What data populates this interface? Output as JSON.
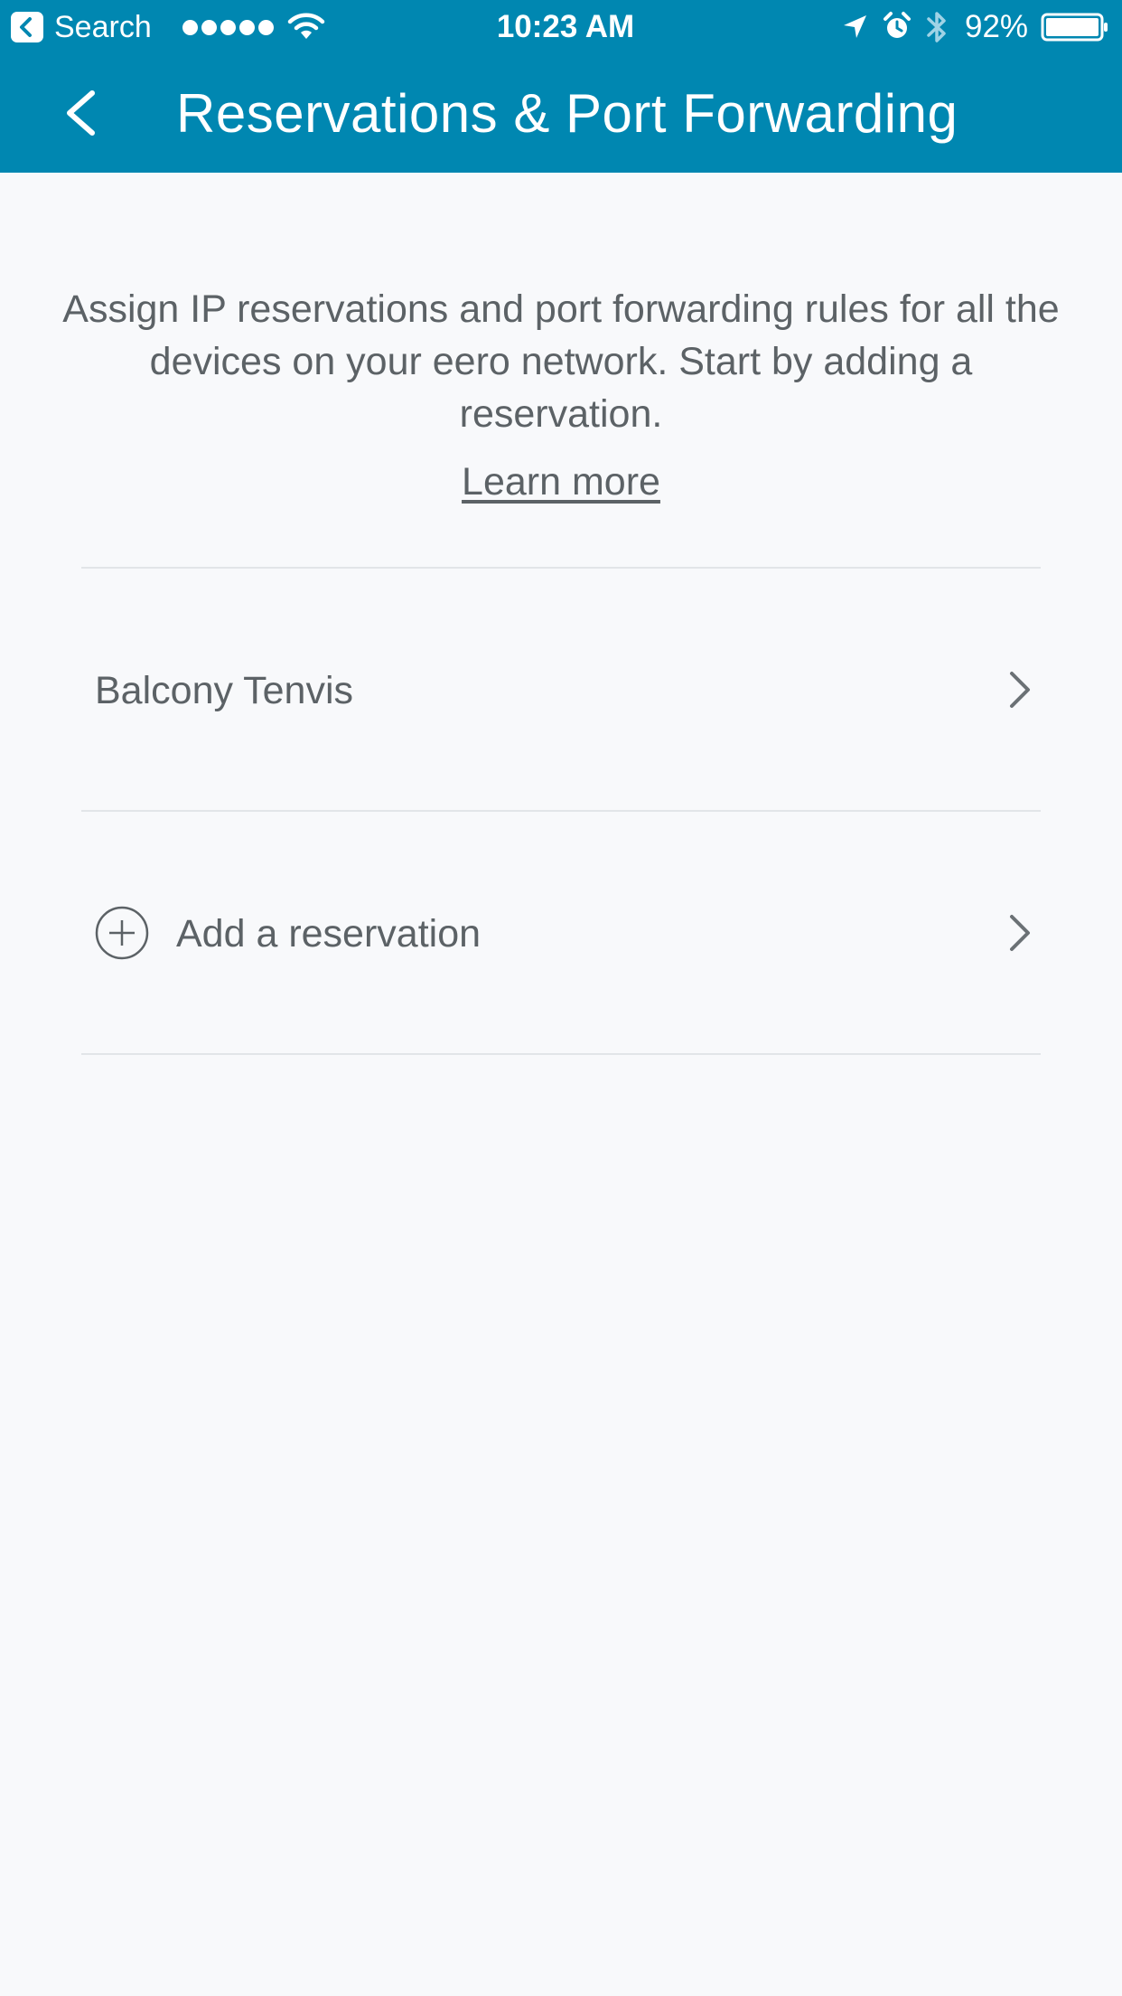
{
  "status_bar": {
    "back_app_label": "Search",
    "time": "10:23 AM",
    "battery_percent": "92%",
    "icons": [
      "back-arrow-icon",
      "signal-dots-icon",
      "wifi-icon",
      "location-arrow-icon",
      "alarm-clock-icon",
      "bluetooth-icon",
      "battery-icon"
    ]
  },
  "nav": {
    "title": "Reservations & Port Forwarding",
    "back_icon": "chevron-left-icon"
  },
  "intro": {
    "description": "Assign IP reservations and port forwarding rules for all the devices on your eero network. Start by adding a reservation.",
    "learn_more": "Learn more"
  },
  "list": {
    "items": [
      {
        "label": "Balcony Tenvis",
        "icon": "chevron-right-icon"
      },
      {
        "label": "Add a reservation",
        "leading_icon": "plus-circle-icon",
        "icon": "chevron-right-icon"
      }
    ]
  },
  "colors": {
    "header_background": "#0087b1",
    "page_background": "#f8f9fb",
    "text": "#5c6266",
    "divider": "#e2e5e8"
  }
}
